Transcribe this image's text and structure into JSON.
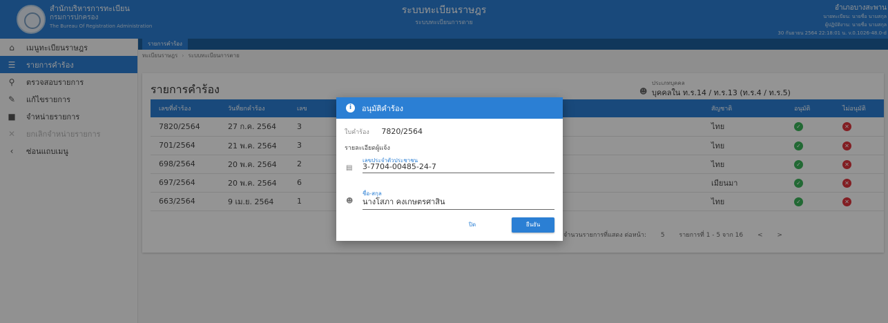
{
  "header": {
    "org_line1": "สำนักบริหารการทะเบียน",
    "org_line2": "กรมการปกครอง",
    "org_line3": "The Bureau Of Registration Administration",
    "title": "ระบบทะเบียนราษฎร",
    "subtitle": "ระบบทะเบียนการตาย",
    "user_line1": "อำเภอบางสะพาน",
    "user_line2": "นายทะเบียน: นายชื่อ นามสกุล",
    "user_line3": "ผู้ปฏิบัติงาน: นายชื่อ นามสกุล",
    "user_line4": "30 กันยายน 2564 22:18:01 น.  v.0.1026-48.0-d"
  },
  "sidebar": {
    "items": [
      {
        "label": "เมนูทะเบียนราษฎร",
        "icon": "home-icon"
      },
      {
        "label": "รายการคำร้อง",
        "icon": "list-icon"
      },
      {
        "label": "ตรวจสอบรายการ",
        "icon": "search-icon"
      },
      {
        "label": "แก้ไขรายการ",
        "icon": "pencil-icon"
      },
      {
        "label": "จำหน่ายรายการ",
        "icon": "trash-icon"
      },
      {
        "label": "ยกเลิกจำหน่ายรายการ",
        "icon": "close-icon"
      },
      {
        "label": "ซ่อนแถบเมนู",
        "icon": "chevron-left-icon"
      }
    ]
  },
  "tabbar": {
    "tab": "รายการคำร้อง"
  },
  "breadcrumb": {
    "root": "ทะเบียนราษฎร",
    "current": "ระบบทะเบียนการตาย"
  },
  "panel": {
    "title": "รายการคำร้อง",
    "person_type_label": "ประเภทบุคคล",
    "person_type_value": "บุคคลใน ท.ร.14 / ท.ร.13 (ท.ร.4 / ท.ร.5)"
  },
  "table": {
    "headers": [
      "เลขที่คำร้อง",
      "วันที่ยกคำร้อง",
      "เลข",
      "",
      "สัญชาติ",
      "อนุมัติ",
      "ไม่อนุมัติ"
    ],
    "rows": [
      {
        "no": "7820/2564",
        "date": "27 ก.ค. 2564",
        "c3": "3",
        "nat": "ไทย"
      },
      {
        "no": "701/2564",
        "date": "21 พ.ค. 2564",
        "c3": "3",
        "nat": "ไทย"
      },
      {
        "no": "698/2564",
        "date": "20 พ.ค. 2564",
        "c3": "2",
        "nat": "ไทย"
      },
      {
        "no": "697/2564",
        "date": "20 พ.ค. 2564",
        "c3": "6",
        "nat": "เมียนมา"
      },
      {
        "no": "663/2564",
        "date": "9 เม.ย. 2564",
        "c3": "1",
        "nat": "ไทย"
      }
    ]
  },
  "pager": {
    "rows_label": "จำนวนรายการที่แสดง ต่อหน้า:",
    "rows_value": "5",
    "range": "รายการที่ 1 - 5 จาก 16",
    "prev": "<",
    "next": ">"
  },
  "dialog": {
    "title": "อนุมัติคำร้อง",
    "req_label": "ใบคำร้อง",
    "req_value": "7820/2564",
    "reporter_heading": "รายละเอียดผู้แจ้ง",
    "id_label": "เลขประจำตัวประชาชน",
    "id_value": "3-7704-00485-24-7",
    "name_label": "ชื่อ-สกุล",
    "name_value": "นางโสภา คงเกษตรศาสิน",
    "cancel": "ปิด",
    "confirm": "ยืนยัน"
  },
  "colors": {
    "primary": "#2b7fd4",
    "approve": "#3cb55a",
    "reject": "#e0353d"
  }
}
